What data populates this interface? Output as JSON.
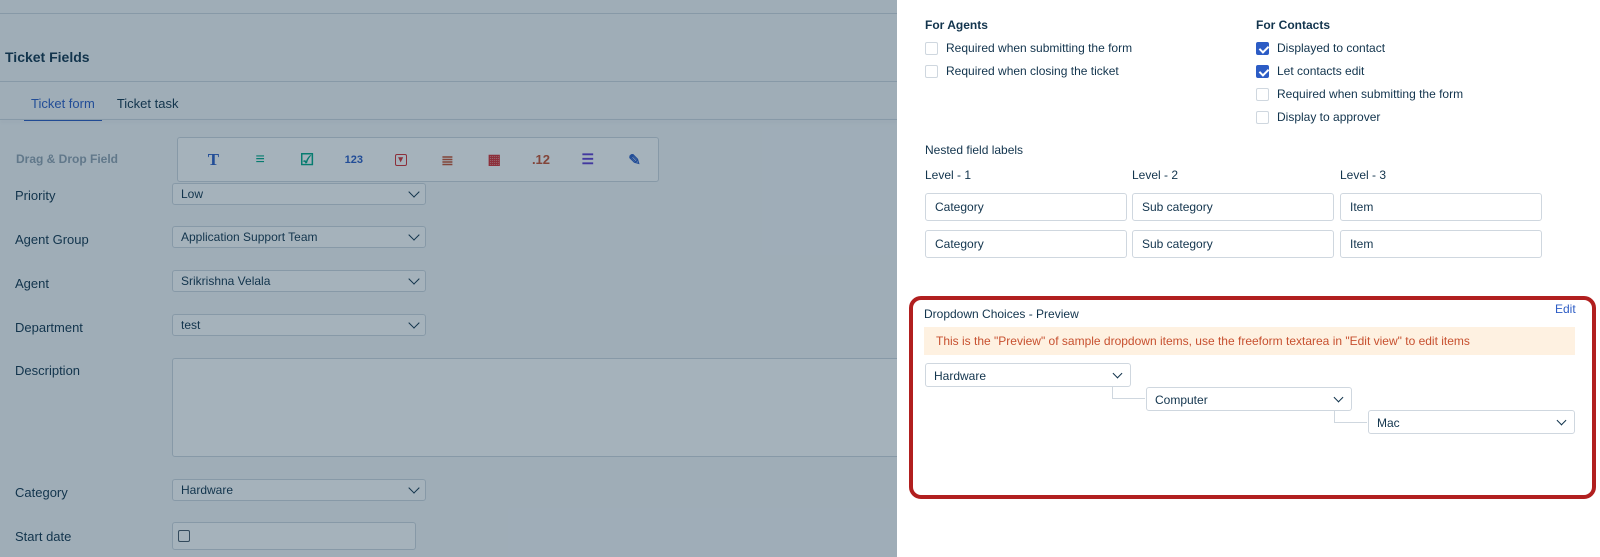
{
  "left": {
    "page_title": "Ticket Fields",
    "tabs": [
      {
        "label": "Ticket form",
        "active": true
      },
      {
        "label": "Ticket task",
        "active": false
      }
    ],
    "dnd_label": "Drag & Drop Field",
    "toolbox_icons": [
      {
        "name": "text-icon",
        "glyph": "T",
        "color": "#2c5cc5"
      },
      {
        "name": "paragraph-icon",
        "glyph": "≡",
        "color": "#00a886"
      },
      {
        "name": "checkbox-icon",
        "glyph": "☑",
        "color": "#00a886"
      },
      {
        "name": "number-icon",
        "glyph": "123",
        "color": "#2c5cc5"
      },
      {
        "name": "dropdown-icon",
        "glyph": "▾",
        "color": "#d72d30"
      },
      {
        "name": "dependent-field-icon",
        "glyph": "≣",
        "color": "#c7502f"
      },
      {
        "name": "date-icon",
        "glyph": "▦",
        "color": "#d72d30"
      },
      {
        "name": "decimal-icon",
        "glyph": ".12",
        "color": "#c7502f"
      },
      {
        "name": "nested-list-icon",
        "glyph": "☰",
        "color": "#5f3ad2"
      },
      {
        "name": "custom-edit-icon",
        "glyph": "✎",
        "color": "#2c5cc5"
      }
    ],
    "fields": {
      "priority": {
        "label": "Priority",
        "value": "Low"
      },
      "agent_group": {
        "label": "Agent Group",
        "value": "Application Support Team"
      },
      "agent": {
        "label": "Agent",
        "value": "Srikrishna Velala"
      },
      "department": {
        "label": "Department",
        "value": "test"
      },
      "description": {
        "label": "Description"
      },
      "category": {
        "label": "Category",
        "value": "Hardware"
      },
      "start_date": {
        "label": "Start date"
      }
    }
  },
  "drawer": {
    "for_agents": {
      "heading": "For Agents",
      "options": [
        {
          "label": "Required when submitting the form",
          "checked": false
        },
        {
          "label": "Required when closing the ticket",
          "checked": false
        }
      ]
    },
    "for_contacts": {
      "heading": "For Contacts",
      "options": [
        {
          "label": "Displayed to contact",
          "checked": true
        },
        {
          "label": "Let contacts edit",
          "checked": true
        },
        {
          "label": "Required when submitting the form",
          "checked": false
        },
        {
          "label": "Display to approver",
          "checked": false
        }
      ]
    },
    "nested_labels": {
      "heading": "Nested field labels",
      "levels": [
        "Level - 1",
        "Level - 2",
        "Level - 3"
      ],
      "row1": [
        "Category",
        "Sub category",
        "Item"
      ],
      "row2": [
        "Category",
        "Sub category",
        "Item"
      ]
    },
    "preview": {
      "title": "Dropdown Choices - Preview",
      "edit_label": "Edit",
      "info": "This is the \"Preview\" of sample dropdown items, use the freeform textarea in \"Edit view\" to edit items",
      "level1": "Hardware",
      "level2": "Computer",
      "level3": "Mac"
    }
  },
  "colors": {
    "accent": "#2c5cc5",
    "highlight_border": "#b11f1f",
    "info_bg": "#fef1e1",
    "info_text": "#c7502f"
  }
}
